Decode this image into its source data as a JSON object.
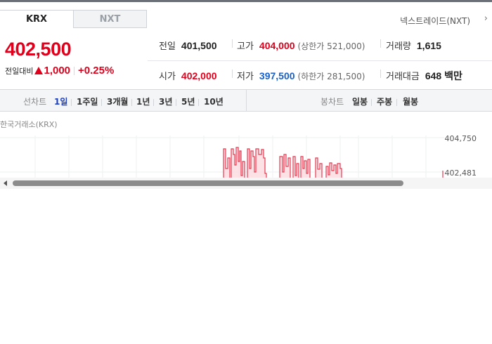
{
  "tabs": [
    {
      "label": "KRX",
      "active": true
    },
    {
      "label": "NXT",
      "active": false
    }
  ],
  "nxt_link": "넥스트레이드(NXT)",
  "nxt_link_icon": "chevron-right-icon",
  "quote": {
    "price": "402,500",
    "change_label": "전일대비",
    "change_direction": "up",
    "change_value": "1,000",
    "change_percent": "+0.25%"
  },
  "stats": {
    "prev_close": {
      "label": "전일",
      "value": "401,500"
    },
    "high": {
      "label": "고가",
      "value": "404,000",
      "sub": "(상한가 521,000)"
    },
    "volume": {
      "label": "거래량",
      "value": "1,615"
    },
    "open": {
      "label": "시가",
      "value": "402,000"
    },
    "low": {
      "label": "저가",
      "value": "397,500",
      "sub": "(하한가 281,500)"
    },
    "trade_value": {
      "label": "거래대금",
      "value": "648 백만"
    }
  },
  "period_bar": {
    "line_label": "선차트",
    "line_periods": [
      "1일",
      "1주일",
      "3개월",
      "1년",
      "3년",
      "5년",
      "10년"
    ],
    "selected_period": "1일",
    "candle_label": "봉차트",
    "candle_periods": [
      "일봉",
      "주봉",
      "월봉"
    ]
  },
  "chart": {
    "source_label": "한국거래소(KRX)",
    "y_top_label": "404,750",
    "y_mid_label": "402,481",
    "line_color": "#e8384f",
    "fill_color": "#fbd9de"
  },
  "colors": {
    "up": "#e0001b",
    "down": "#1a5fc8",
    "selected": "#1a3fc8"
  }
}
